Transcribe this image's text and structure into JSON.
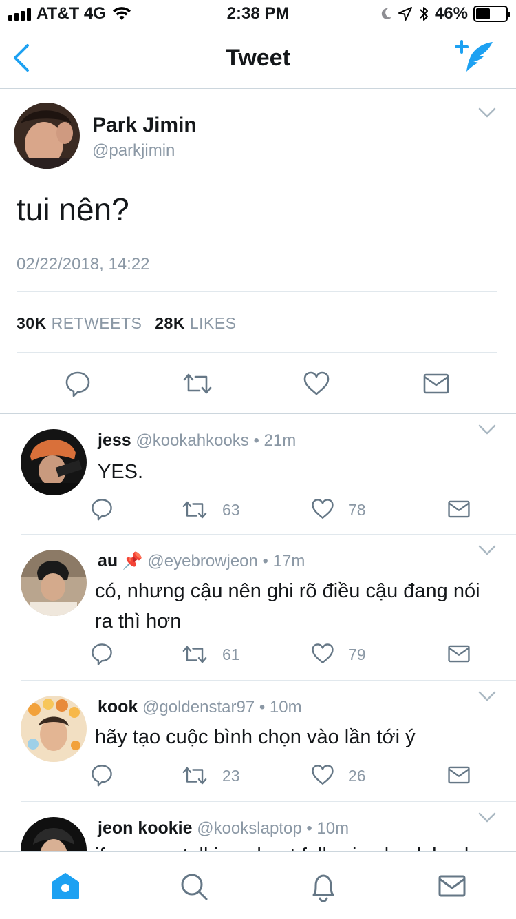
{
  "status": {
    "carrier": "AT&T 4G",
    "time": "2:38 PM",
    "battery": "46%",
    "battery_level": 0.46
  },
  "nav": {
    "title": "Tweet",
    "back_icon": "chevron-left-icon",
    "compose_icon": "compose-tweet-icon"
  },
  "tweet": {
    "name": "Park Jimin",
    "handle": "@parkjimin",
    "text": "tui nên?",
    "date": "02/22/2018, 14:22",
    "retweets_count": "30K",
    "retweets_label": "RETWEETS",
    "likes_count": "28K",
    "likes_label": "LIKES"
  },
  "replies": [
    {
      "name": "jess",
      "handle": "@kookahkooks",
      "time": "21m",
      "text": "YES.",
      "retweets": "63",
      "likes": "78"
    },
    {
      "name": "au",
      "emoji": "📌",
      "handle": "@eyebrowjeon",
      "time": "17m",
      "text": "có, nhưng cậu nên ghi rõ điều cậu đang nói ra thì hơn",
      "retweets": "61",
      "likes": "79"
    },
    {
      "name": "kook",
      "handle": "@goldenstar97",
      "time": "10m",
      "text": "hãy tạo cuộc bình chọn vào lần tới ý",
      "retweets": "23",
      "likes": "26"
    },
    {
      "name": "jeon kookie",
      "handle": "@kookslaptop",
      "time": "10m",
      "text": "if you are talking about following kook back"
    }
  ],
  "dot": "•",
  "tabs": [
    "home-icon",
    "search-icon",
    "notifications-icon",
    "messages-icon"
  ],
  "colors": {
    "accent": "#1da1f2",
    "muted": "#8b98a5",
    "icon": "#657786"
  }
}
